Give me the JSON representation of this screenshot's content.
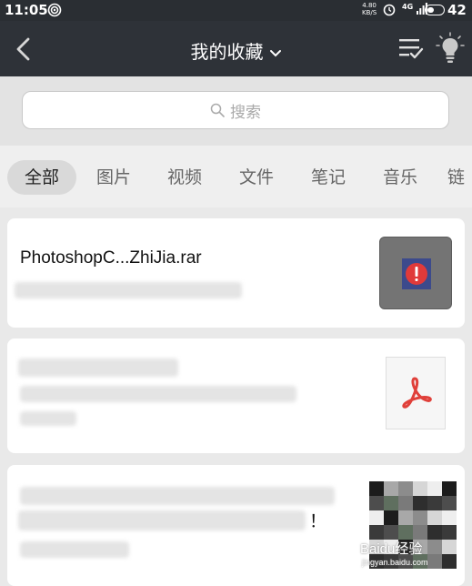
{
  "status_bar": {
    "time": "11:05",
    "speed_value": "4.80",
    "speed_unit": "KB/S",
    "signal_label": "4G",
    "battery_level": "42",
    "battery_fraction": 0.42
  },
  "header": {
    "title": "我的收藏"
  },
  "search": {
    "placeholder": "搜索"
  },
  "tabs": [
    {
      "label": "全部",
      "active": true
    },
    {
      "label": "图片",
      "active": false
    },
    {
      "label": "视频",
      "active": false
    },
    {
      "label": "文件",
      "active": false
    },
    {
      "label": "笔记",
      "active": false
    },
    {
      "label": "音乐",
      "active": false
    },
    {
      "label": "链",
      "active": false
    }
  ],
  "items": [
    {
      "title": "PhotoshopC...ZhiJia.rar",
      "thumbnail": "rar-file-icon"
    },
    {
      "thumbnail": "pdf-file-icon"
    },
    {
      "trailing_text": "！",
      "thumbnail": "mosaic-image"
    }
  ],
  "watermark": {
    "text": "Baidu经验",
    "subtext": "jingyan.baidu.com"
  },
  "colors": {
    "header_bg": "#2e3238",
    "status_bg": "#2a2e33",
    "pdf_red": "#e0403a",
    "rar_badge": "#e03a3a",
    "rar_badge_bg": "#3c4a8c"
  }
}
